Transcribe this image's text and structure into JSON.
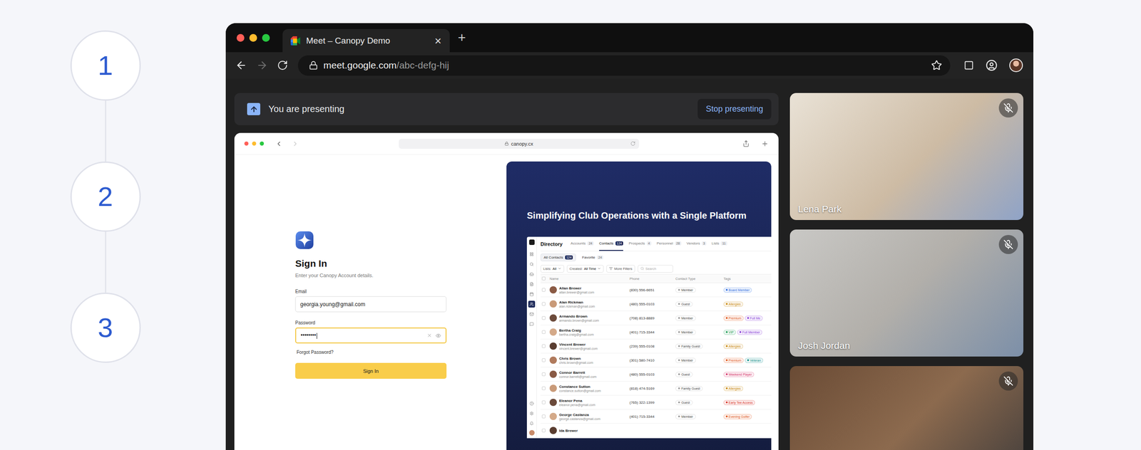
{
  "steps": [
    {
      "label": "1"
    },
    {
      "label": "2"
    },
    {
      "label": "3"
    }
  ],
  "browser": {
    "tab": {
      "title": "Meet – Canopy Demo",
      "close": "×"
    },
    "new_tab": "+",
    "nav": {
      "back_enabled": true,
      "forward_enabled": false
    },
    "url": {
      "host": "meet.google.com",
      "path": "/abc-defg-hij"
    }
  },
  "presenting": {
    "message": "You are presenting",
    "button": "Stop presenting"
  },
  "shared_screen": {
    "nav": {
      "back_enabled": true,
      "forward_enabled": false
    },
    "url": "canopy.cx",
    "sign_in": {
      "title": "Sign In",
      "subtitle": "Enter your Canopy Account details.",
      "fields": [
        {
          "label": "Email",
          "value": "georgia.young@gmail.com",
          "kind": "text",
          "focused": false
        },
        {
          "label": "Password",
          "value": "••••••••",
          "kind": "password",
          "focused": true
        }
      ],
      "forgot": "Forgot Password?",
      "button": "Sign In"
    },
    "promo": {
      "title": "Simplifying Club Operations with a Single Platform",
      "directory": {
        "title": "Directory",
        "sidebar_items": [
          {
            "selected": false
          },
          {
            "selected": false
          },
          {
            "selected": false
          },
          {
            "selected": false
          },
          {
            "selected": false
          },
          {
            "selected": true
          },
          {
            "selected": false
          },
          {
            "selected": false
          }
        ],
        "tabs": [
          {
            "label": "Accounts",
            "count": "24",
            "selected": false
          },
          {
            "label": "Contacts",
            "count": "124",
            "selected": true
          },
          {
            "label": "Prospects",
            "count": "4",
            "selected": false
          },
          {
            "label": "Personnel",
            "count": "28",
            "selected": false
          },
          {
            "label": "Vendors",
            "count": "3",
            "selected": false
          },
          {
            "label": "Lists",
            "count": "11",
            "selected": false
          }
        ],
        "views": [
          {
            "label": "All Contacts",
            "count": "124",
            "selected": true
          },
          {
            "label": "Favorite",
            "count": "24",
            "selected": false
          }
        ],
        "filters": [
          {
            "label": "Lists:",
            "value": "All"
          },
          {
            "label": "Created:",
            "value": "All Time"
          },
          {
            "label": "More Filters"
          }
        ],
        "search_placeholder": "Search",
        "columns": [
          "Name",
          "Phone",
          "Contact Type",
          "Tags"
        ],
        "rows": [
          {
            "name": "Allan Brewer",
            "email": "allan.brewer@gmail.com",
            "phone": "(830) 556-6651",
            "type": "Member",
            "tags": [
              {
                "label": "Board Member",
                "color": "#2f6fe0"
              }
            ]
          },
          {
            "name": "Alan Rickman",
            "email": "alan.rickman@gmail.com",
            "phone": "(480) 555-0103",
            "type": "Guest",
            "tags": [
              {
                "label": "Allergies",
                "color": "#c98a12"
              }
            ]
          },
          {
            "name": "Armando Brown",
            "email": "armando.brown@gmail.com",
            "phone": "(708) 813-8889",
            "type": "Member",
            "tags": [
              {
                "label": "Premium",
                "color": "#e0561b"
              },
              {
                "label": "Full Me",
                "color": "#8b3fd9"
              }
            ]
          },
          {
            "name": "Bertha Craig",
            "email": "bertha.craig@gmail.com",
            "phone": "(401) 715-3344",
            "type": "Member",
            "tags": [
              {
                "label": "VIP",
                "color": "#1f9d55"
              },
              {
                "label": "Full Member",
                "color": "#8b3fd9"
              }
            ]
          },
          {
            "name": "Vincent Brewer",
            "email": "vincent.brewer@gmail.com",
            "phone": "(239) 555-0108",
            "type": "Family Guest",
            "tags": [
              {
                "label": "Allergies",
                "color": "#c98a12"
              }
            ]
          },
          {
            "name": "Chris Brown",
            "email": "chris.brown@gmail.com",
            "phone": "(301) 580-7410",
            "type": "Member",
            "tags": [
              {
                "label": "Premium",
                "color": "#e0561b"
              },
              {
                "label": "Veteran",
                "color": "#0f8f8a"
              }
            ]
          },
          {
            "name": "Connor Barrett",
            "email": "connor.barrett@gmail.com",
            "phone": "(480) 555-0103",
            "type": "Guest",
            "tags": [
              {
                "label": "Weekend Player",
                "color": "#d6336c"
              }
            ]
          },
          {
            "name": "Constance Sutton",
            "email": "constance.sutton@gmail.com",
            "phone": "(818) 474-5169",
            "type": "Family Guest",
            "tags": [
              {
                "label": "Allergies",
                "color": "#c98a12"
              }
            ]
          },
          {
            "name": "Eleanor Pena",
            "email": "eleanor.pena@gmail.com",
            "phone": "(765) 322-1399",
            "type": "Guest",
            "tags": [
              {
                "label": "Early Tee Access",
                "color": "#d9342b"
              }
            ]
          },
          {
            "name": "George Castanza",
            "email": "george.castanza@gmail.com",
            "phone": "(401) 715-3344",
            "type": "Member",
            "tags": [
              {
                "label": "Evening Golfer",
                "color": "#e0561b"
              }
            ]
          },
          {
            "name": "Ida Brewer"
          }
        ]
      }
    }
  },
  "participants": [
    {
      "name": "Lena Park",
      "muted": true
    },
    {
      "name": "Josh Jordan",
      "muted": true
    },
    {
      "muted": true
    }
  ]
}
